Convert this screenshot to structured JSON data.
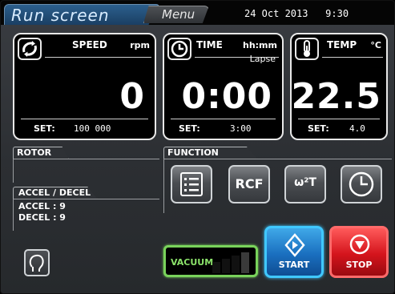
{
  "header": {
    "run_tab": "Run screen",
    "menu_tab": "Menu",
    "date": "24 Oct 2013",
    "time": "9:30"
  },
  "speed": {
    "title": "SPEED",
    "unit": "rpm",
    "value": "0",
    "set_label": "SET:",
    "set_value": "100 000",
    "icon": "spin-icon"
  },
  "time_panel": {
    "title": "TIME",
    "unit": "hh:mm",
    "mode": "Lapse",
    "value": "0:00",
    "set_label": "SET:",
    "set_value": "3:00",
    "icon": "clock-icon"
  },
  "temp": {
    "title": "TEMP",
    "unit": "°C",
    "value": "22.5",
    "set_label": "SET:",
    "set_value": "4.0",
    "icon": "thermometer-icon"
  },
  "rotor": {
    "label": "ROTOR"
  },
  "accel_decel": {
    "label": "ACCEL / DECEL",
    "accel": "ACCEL :  9",
    "decel": "DECEL :  9"
  },
  "function": {
    "label": "FUNCTION",
    "buttons": [
      {
        "name": "list",
        "icon": "list-icon",
        "label": ""
      },
      {
        "name": "rcf",
        "icon": "",
        "label": "RCF"
      },
      {
        "name": "w2t",
        "icon": "",
        "label": "ω²T"
      },
      {
        "name": "timer",
        "icon": "clock-icon",
        "label": ""
      }
    ]
  },
  "vacuum": {
    "label": "VACUUM",
    "level": 0.75
  },
  "controls": {
    "start": "START",
    "stop": "STOP"
  },
  "colors": {
    "start": "#1a6fbf",
    "stop": "#d4141c",
    "vacuum": "#79d35b",
    "run_tab": "#2c5f8d"
  }
}
